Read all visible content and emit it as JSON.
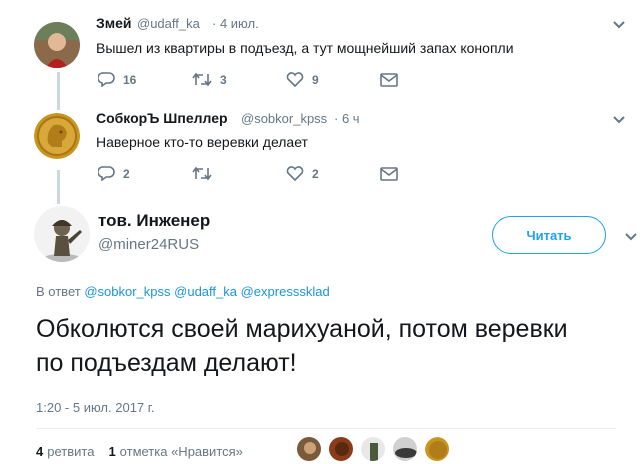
{
  "tweet1": {
    "name": "Змей",
    "handle": "@udaff_ka",
    "time": "· 4 июл.",
    "text": "Вышел из квартиры в подъезд, а тут мощнейший запах конопли",
    "replies": "16",
    "retweets": "3",
    "likes": "9"
  },
  "tweet2": {
    "name": "СобкорЪ Шпеллер",
    "handle": "@sobkor_kpss",
    "time": "· 6 ч",
    "text": "Наверное кто-то веревки делает",
    "replies": "2",
    "retweets": "",
    "likes": "2"
  },
  "main": {
    "name": "тов. Инженер",
    "handle": "@miner24RUS",
    "follow_label": "Читать",
    "reply_prefix": "В ответ",
    "mentions": [
      "@sobkor_kpss",
      "@udaff_ka",
      "@expresssklad"
    ],
    "text": "Обколются своей марихуаной, потом веревки по подъездам делают!",
    "timestamp": "1:20 - 5 июл. 2017 г.",
    "retweet_count": "4",
    "retweet_label": "ретвита",
    "like_count": "1",
    "like_label": "отметка «Нравится»"
  },
  "icons": {
    "reply": "reply-icon",
    "retweet": "retweet-icon",
    "like": "heart-icon",
    "dm": "envelope-icon",
    "more": "chevron-down-icon"
  },
  "colors": {
    "accent": "#1da1f2",
    "link": "#1b95e0",
    "muted": "#657786",
    "line": "#ccd6dd"
  }
}
